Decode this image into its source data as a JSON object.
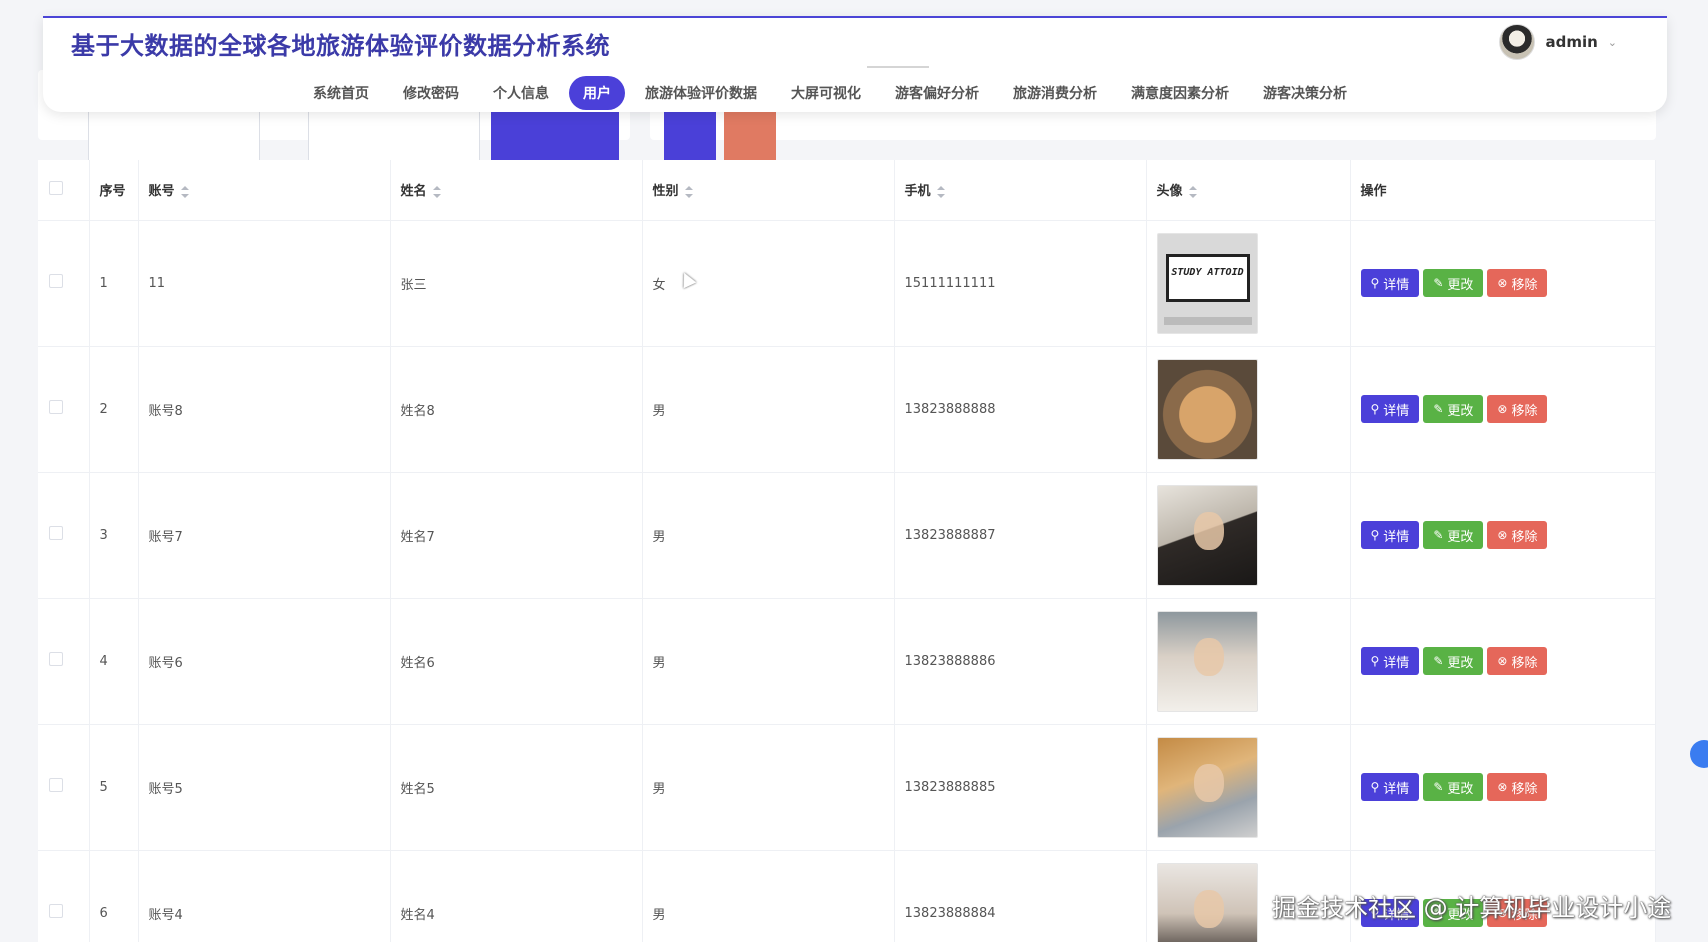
{
  "app": {
    "title": "基于大数据的全球各地旅游体验评价数据分析系统"
  },
  "user": {
    "name": "admin"
  },
  "nav": {
    "items": [
      {
        "label": "系统首页"
      },
      {
        "label": "修改密码"
      },
      {
        "label": "个人信息"
      },
      {
        "label": "用户"
      },
      {
        "label": "旅游体验评价数据"
      },
      {
        "label": "大屏可视化"
      },
      {
        "label": "游客偏好分析"
      },
      {
        "label": "旅游消费分析"
      },
      {
        "label": "满意度因素分析"
      },
      {
        "label": "游客决策分析"
      }
    ],
    "active": "用户"
  },
  "table": {
    "headers": {
      "index": "序号",
      "account": "账号",
      "name": "姓名",
      "gender": "性别",
      "phone": "手机",
      "avatar": "头像",
      "actions": "操作"
    },
    "actions": {
      "detail": "详情",
      "edit": "更改",
      "remove": "移除"
    },
    "rows": [
      {
        "index": "1",
        "account": "11",
        "name": "张三",
        "gender": "女",
        "phone": "15111111111",
        "avatar_text": "STUDY ATTOID"
      },
      {
        "index": "2",
        "account": "账号8",
        "name": "姓名8",
        "gender": "男",
        "phone": "13823888888"
      },
      {
        "index": "3",
        "account": "账号7",
        "name": "姓名7",
        "gender": "男",
        "phone": "13823888887"
      },
      {
        "index": "4",
        "account": "账号6",
        "name": "姓名6",
        "gender": "男",
        "phone": "13823888886"
      },
      {
        "index": "5",
        "account": "账号5",
        "name": "姓名5",
        "gender": "男",
        "phone": "13823888885"
      },
      {
        "index": "6",
        "account": "账号4",
        "name": "姓名4",
        "gender": "男",
        "phone": "13823888884"
      }
    ]
  },
  "watermark": "掘金技术社区 @ 计算机毕业设计小途",
  "colors": {
    "primary": "#4b40d9",
    "edit": "#59b245",
    "remove": "#e5675a",
    "title": "#3b3aa8"
  }
}
